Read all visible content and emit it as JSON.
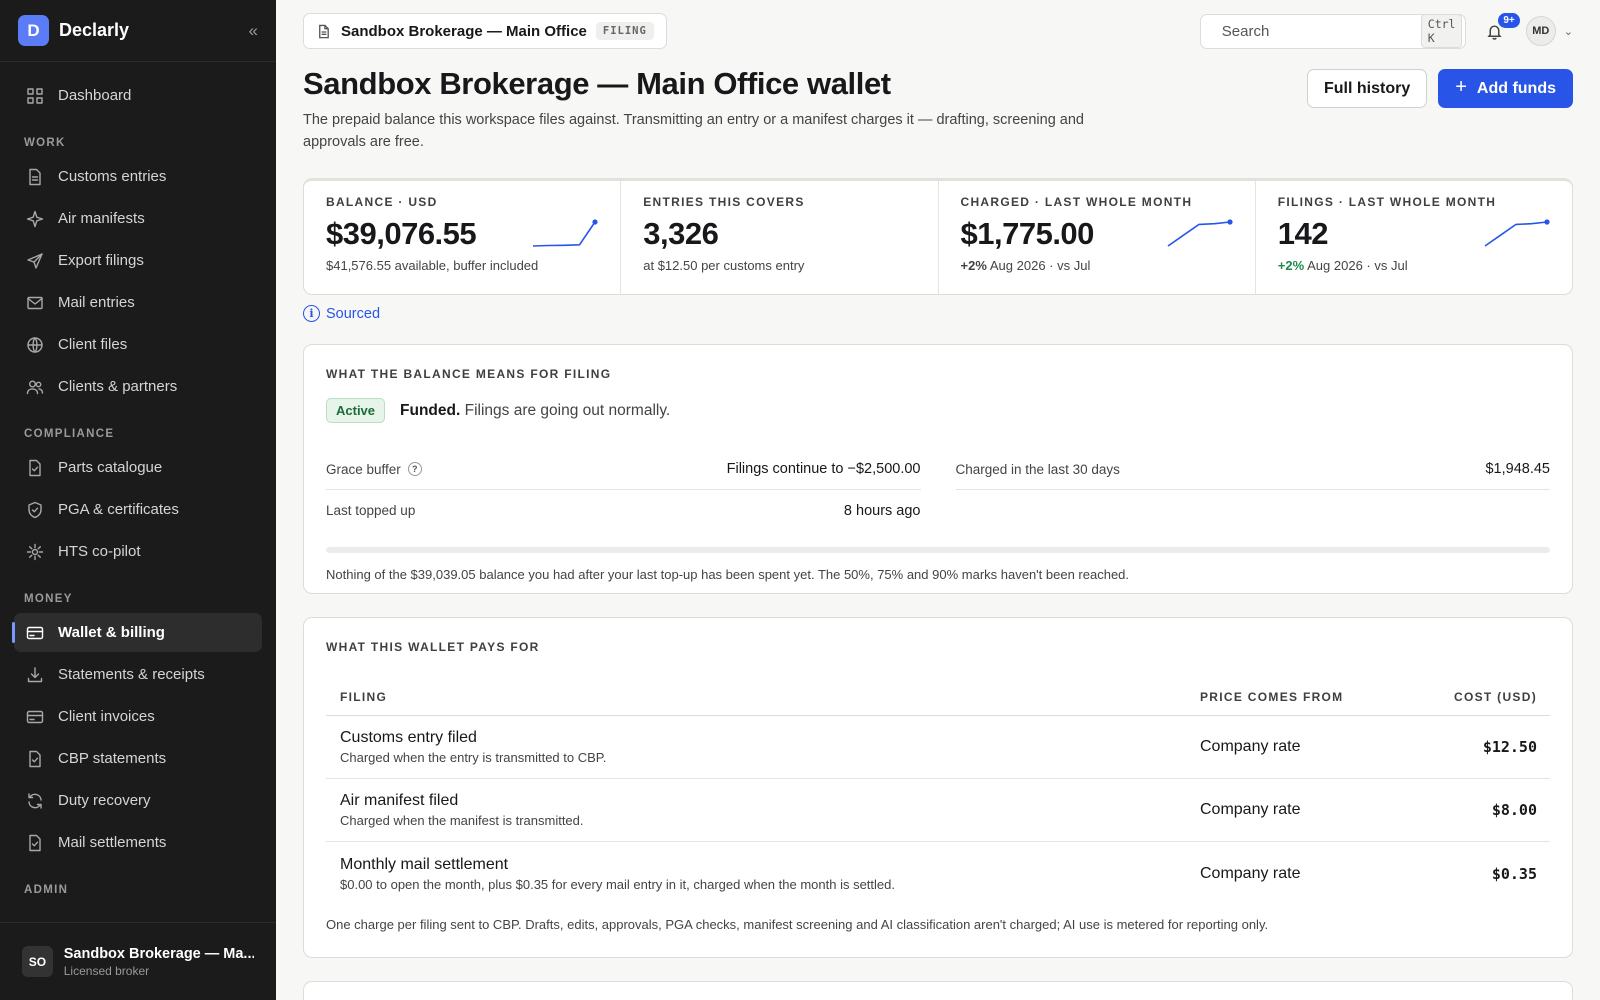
{
  "brand": {
    "initial": "D",
    "name": "Declarly",
    "collapse_glyph": "«"
  },
  "nav": {
    "top": [
      {
        "label": "Dashboard",
        "icon": "grid-icon"
      }
    ],
    "sections": [
      {
        "label": "WORK",
        "items": [
          {
            "label": "Customs entries",
            "icon": "document-icon"
          },
          {
            "label": "Air manifests",
            "icon": "sparkle-icon"
          },
          {
            "label": "Export filings",
            "icon": "send-icon"
          },
          {
            "label": "Mail entries",
            "icon": "mail-icon"
          },
          {
            "label": "Client files",
            "icon": "globe-icon"
          },
          {
            "label": "Clients & partners",
            "icon": "users-icon"
          }
        ]
      },
      {
        "label": "COMPLIANCE",
        "items": [
          {
            "label": "Parts catalogue",
            "icon": "checklist-icon"
          },
          {
            "label": "PGA & certificates",
            "icon": "shield-icon"
          },
          {
            "label": "HTS co-pilot",
            "icon": "sun-icon"
          }
        ]
      },
      {
        "label": "MONEY",
        "items": [
          {
            "label": "Wallet & billing",
            "icon": "card-icon",
            "active": true
          },
          {
            "label": "Statements & receipts",
            "icon": "download-icon"
          },
          {
            "label": "Client invoices",
            "icon": "card-icon"
          },
          {
            "label": "CBP statements",
            "icon": "checklist-icon"
          },
          {
            "label": "Duty recovery",
            "icon": "refresh-icon"
          },
          {
            "label": "Mail settlements",
            "icon": "checklist-icon"
          }
        ]
      },
      {
        "label": "ADMIN",
        "items": []
      }
    ]
  },
  "account": {
    "initials": "SO",
    "name": "Sandbox Brokerage — Ma...",
    "role": "Licensed broker"
  },
  "topbar": {
    "workspace": "Sandbox Brokerage — Main Office",
    "workspace_tag": "FILING",
    "search_placeholder": "Search",
    "search_shortcut": "Ctrl K",
    "notifications_badge": "9+",
    "user_initials": "MD",
    "user_caret": "⌄"
  },
  "page": {
    "title": "Sandbox Brokerage — Main Office wallet",
    "description": "The prepaid balance this workspace files against. Transmitting an entry or a manifest charges it — drafting, screening and approvals are free.",
    "full_history_label": "Full history",
    "add_funds_label": "Add funds",
    "add_funds_glyph": "+"
  },
  "stats": [
    {
      "label": "BALANCE · USD",
      "value": "$39,076.55",
      "sub": "$41,576.55 available, buffer included",
      "delta": "",
      "spark": [
        0.0,
        0.02,
        0.03,
        0.05,
        1.0
      ]
    },
    {
      "label": "ENTRIES THIS COVERS",
      "value": "3,326",
      "sub": "at $12.50 per customs entry",
      "delta": "",
      "spark": []
    },
    {
      "label": "CHARGED · LAST WHOLE MONTH",
      "value": "$1,775.00",
      "sub": "Aug 2026 · vs Jul",
      "delta": "+2%",
      "delta_positive": false,
      "spark": [
        0.0,
        0.45,
        0.9,
        0.93,
        1.0
      ]
    },
    {
      "label": "FILINGS · LAST WHOLE MONTH",
      "value": "142",
      "sub": "Aug 2026 · vs Jul",
      "delta": "+2%",
      "delta_positive": true,
      "spark": [
        0.0,
        0.45,
        0.9,
        0.93,
        1.0
      ]
    }
  ],
  "colors": {
    "accent": "#2855e8",
    "positive": "#1f8a4c",
    "spark": "#2855e8"
  },
  "sourced_label": "Sourced",
  "balance_card": {
    "label": "WHAT THE BALANCE MEANS FOR FILING",
    "status_badge": "Active",
    "status_bold": "Funded.",
    "status_text": " Filings are going out normally.",
    "grace_label": "Grace buffer",
    "grace_value": "Filings continue to −$2,500.00",
    "topped_label": "Last topped up",
    "topped_value": "8 hours ago",
    "charged_label": "Charged in the last 30 days",
    "charged_value": "$1,948.45",
    "spent_fraction": 0,
    "note": "Nothing of the $39,039.05 balance you had after your last top-up has been spent yet. The 50%, 75% and 90% marks haven't been reached."
  },
  "pays_card": {
    "label": "WHAT THIS WALLET PAYS FOR",
    "columns": [
      "FILING",
      "PRICE COMES FROM",
      "COST (USD)"
    ],
    "rows": [
      {
        "name": "Customs entry filed",
        "desc": "Charged when the entry is transmitted to CBP.",
        "source": "Company rate",
        "cost": "$12.50"
      },
      {
        "name": "Air manifest filed",
        "desc": "Charged when the manifest is transmitted.",
        "source": "Company rate",
        "cost": "$8.00"
      },
      {
        "name": "Monthly mail settlement",
        "desc": "$0.00 to open the month, plus $0.35 for every mail entry in it, charged when the month is settled.",
        "source": "Company rate",
        "cost": "$0.35"
      }
    ],
    "note": "One charge per filing sent to CBP. Drafts, edits, approvals, PGA checks, manifest screening and AI classification aren't charged; AI use is metered for reporting only."
  }
}
